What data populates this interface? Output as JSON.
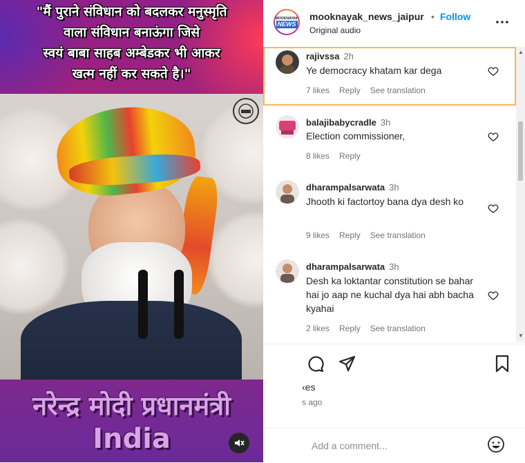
{
  "media": {
    "top_text": [
      "\"मैं पुराने संविधान को बदलकर मनुस्मृति",
      "वाला संविधान बनाऊंगा जिसे",
      "स्वयं बाबा साहब अम्बेडकर भी आकर",
      "खत्म नहीं कर सकते है।\""
    ],
    "bottom_line1": "नरेन्द्र मोदी प्रधानमंत्री",
    "bottom_line2": "India",
    "mute_icon": "speaker-muted-icon"
  },
  "header": {
    "username": "mooknayak_news_jaipur",
    "separator": "•",
    "follow_label": "Follow",
    "subtitle": "Original audio",
    "logo_top": "MOOKNAYAK",
    "logo_bottom": "NEWS",
    "more_icon": "more-options-icon"
  },
  "comments": [
    {
      "user": "rajivssa",
      "time": "2h",
      "text": "Ye democracy khatam kar dega",
      "likes": "7 likes",
      "reply": "Reply",
      "translate": "See translation",
      "avatar_color": "#5a4a3a"
    },
    {
      "user": "balajibabycradle",
      "time": "3h",
      "text": "Election commissioner,",
      "likes": "8 likes",
      "reply": "Reply",
      "translate": "",
      "avatar_color": "#d9407a"
    },
    {
      "user": "dharampalsarwata",
      "time": "3h",
      "text": "Jhooth ki factortoy bana dya desh ko",
      "likes": "9 likes",
      "reply": "Reply",
      "translate": "See translation",
      "avatar_color": "#6a5a50"
    },
    {
      "user": "dharampalsarwata",
      "time": "3h",
      "text": "Desh ka loktantar constitution se bahar hai jo aap ne kuchal dya hai abh bacha kyahai",
      "likes": "2 likes",
      "reply": "Reply",
      "translate": "See translation",
      "avatar_color": "#6a5a50"
    }
  ],
  "actions": {
    "comment_icon": "comment-icon",
    "share_icon": "share-icon",
    "save_icon": "bookmark-icon",
    "likes_partial": "‹es",
    "ago_partial": "s ago"
  },
  "add_comment": {
    "placeholder": "Add a comment...",
    "emoji_icon": "emoji-icon"
  },
  "colors": {
    "follow": "#0095f6",
    "highlight": "#f5b759",
    "text": "#262626",
    "muted": "#737373"
  }
}
